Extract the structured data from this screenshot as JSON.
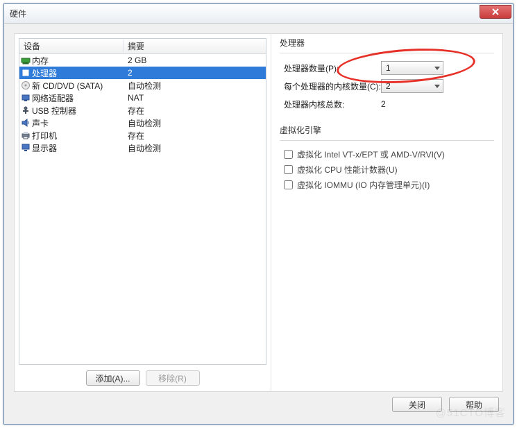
{
  "window": {
    "title": "硬件"
  },
  "left": {
    "header_device": "设备",
    "header_summary": "摘要",
    "items": [
      {
        "icon": "memory",
        "name": "内存",
        "summary": "2 GB",
        "selected": false
      },
      {
        "icon": "cpu",
        "name": "处理器",
        "summary": "2",
        "selected": true
      },
      {
        "icon": "cd",
        "name": "新 CD/DVD (SATA)",
        "summary": "自动检测",
        "selected": false
      },
      {
        "icon": "network",
        "name": "网络适配器",
        "summary": "NAT",
        "selected": false
      },
      {
        "icon": "usb",
        "name": "USB 控制器",
        "summary": "存在",
        "selected": false
      },
      {
        "icon": "sound",
        "name": "声卡",
        "summary": "自动检测",
        "selected": false
      },
      {
        "icon": "printer",
        "name": "打印机",
        "summary": "存在",
        "selected": false
      },
      {
        "icon": "display",
        "name": "显示器",
        "summary": "自动检测",
        "selected": false
      }
    ],
    "add_btn": "添加(A)...",
    "remove_btn": "移除(R)"
  },
  "right": {
    "processors_group": "处理器",
    "num_processors_label": "处理器数量(P):",
    "num_processors_value": "1",
    "cores_per_label": "每个处理器的内核数量(C):",
    "cores_per_value": "2",
    "total_cores_label": "处理器内核总数:",
    "total_cores_value": "2",
    "virt_group": "虚拟化引擎",
    "virt_vt": "虚拟化 Intel VT-x/EPT 或 AMD-V/RVI(V)",
    "virt_perf": "虚拟化 CPU 性能计数器(U)",
    "virt_iommu": "虚拟化 IOMMU (IO 内存管理单元)(I)"
  },
  "footer": {
    "close": "关闭",
    "help": "帮助"
  },
  "watermark": "@51CTO博客"
}
